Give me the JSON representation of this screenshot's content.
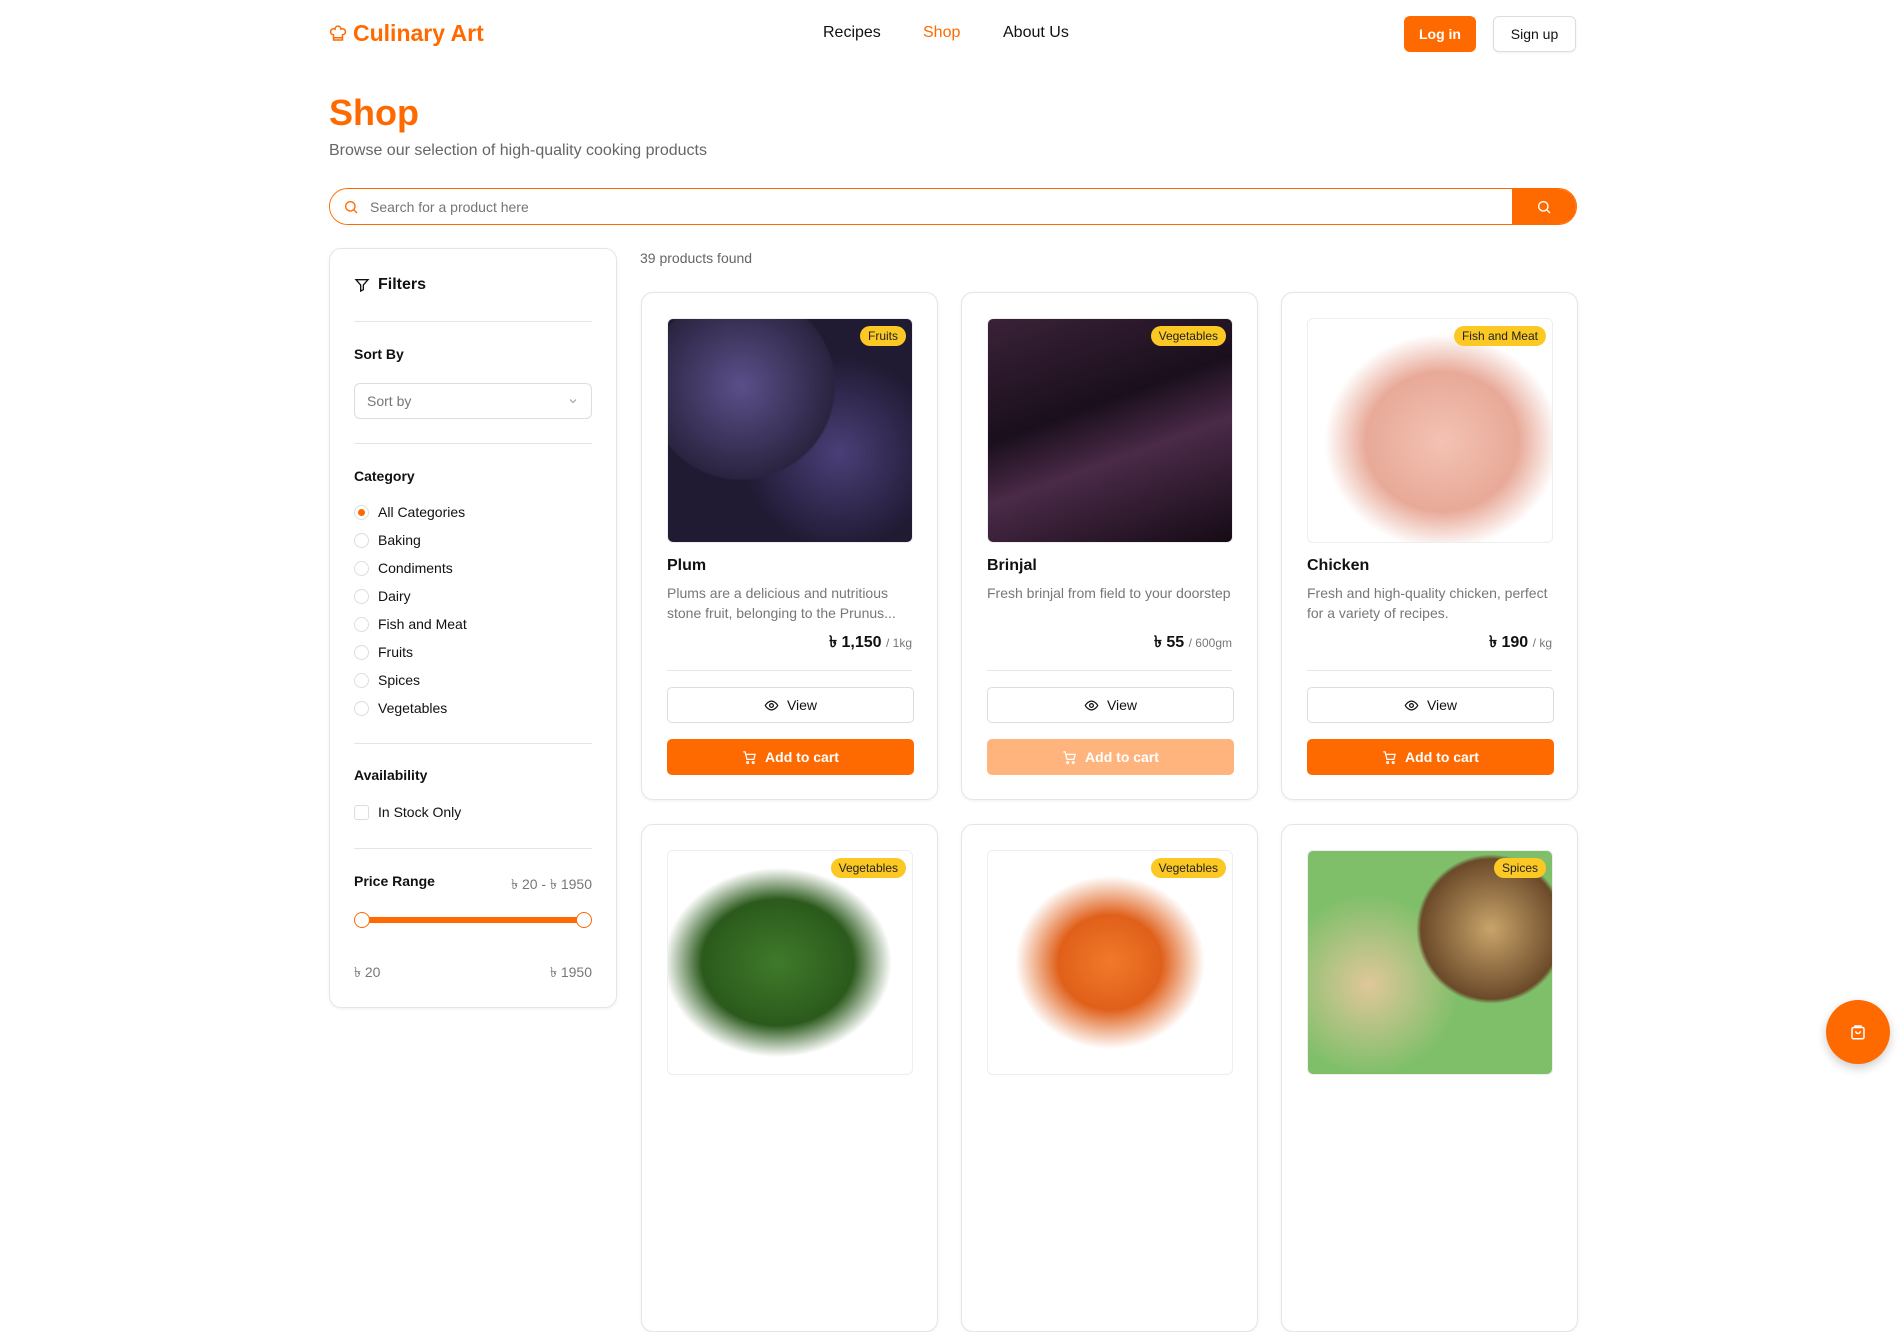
{
  "brand": {
    "name": "Culinary Art",
    "accent": "#ff6a00",
    "badge_color": "#fcc823"
  },
  "nav": {
    "items": [
      "Recipes",
      "Shop",
      "About Us"
    ],
    "active": "Shop"
  },
  "auth": {
    "login": "Log in",
    "signup": "Sign up"
  },
  "page": {
    "title": "Shop",
    "subtitle": "Browse our selection of high-quality cooking products"
  },
  "search": {
    "placeholder": "Search for a product here",
    "value": ""
  },
  "filters": {
    "title": "Filters",
    "sort_label": "Sort By",
    "sort_placeholder": "Sort by",
    "category_label": "Category",
    "categories": [
      "All Categories",
      "Baking",
      "Condiments",
      "Dairy",
      "Fish and Meat",
      "Fruits",
      "Spices",
      "Vegetables"
    ],
    "selected_category": "All Categories",
    "availability_label": "Availability",
    "in_stock_label": "In Stock Only",
    "in_stock_checked": false,
    "price_label": "Price Range",
    "price_summary": "৳ 20 - ৳ 1950",
    "price_min": "৳ 20",
    "price_max": "৳ 1950",
    "range_min": 20,
    "range_max": 1950,
    "selected_min": 20,
    "selected_max": 1950
  },
  "results": {
    "count_text": "39 products found"
  },
  "products": [
    {
      "name": "Plum",
      "category": "Fruits",
      "desc": "Plums are a delicious and nutritious stone fruit, belonging to the Prunus...",
      "price": "৳ 1,150",
      "unit": "/ 1kg",
      "view": "View",
      "cart": "Add to cart",
      "cart_disabled": false
    },
    {
      "name": "Brinjal",
      "category": "Vegetables",
      "desc": "Fresh brinjal from field to your doorstep",
      "price": "৳ 55",
      "unit": "/ 600gm",
      "view": "View",
      "cart": "Add to cart",
      "cart_disabled": true
    },
    {
      "name": "Chicken",
      "category": "Fish and Meat",
      "desc": "Fresh and high-quality chicken, perfect for a variety of recipes.",
      "price": "৳ 190",
      "unit": "/ kg",
      "view": "View",
      "cart": "Add to cart",
      "cart_disabled": false
    },
    {
      "category": "Vegetables"
    },
    {
      "category": "Vegetables"
    },
    {
      "category": "Spices"
    }
  ]
}
